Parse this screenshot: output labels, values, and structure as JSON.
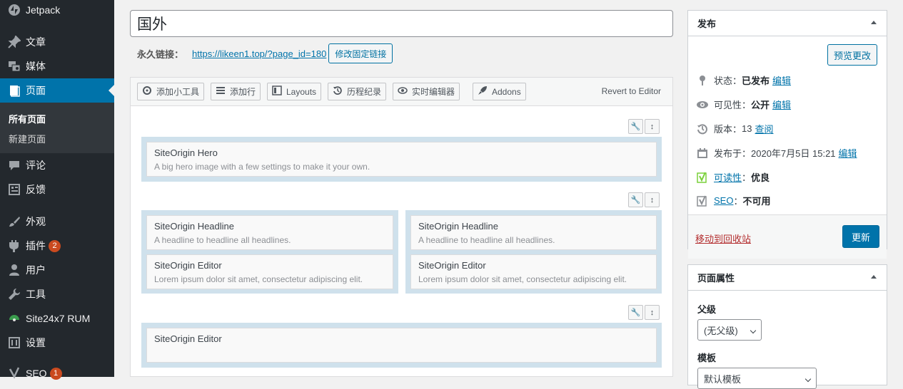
{
  "sidebar": {
    "items": [
      {
        "label": "Jetpack",
        "icon": "jetpack-icon"
      },
      {
        "label": "文章",
        "icon": "pin-icon"
      },
      {
        "label": "媒体",
        "icon": "media-icon"
      },
      {
        "label": "页面",
        "icon": "page-icon"
      },
      {
        "label": "评论",
        "icon": "comment-icon"
      },
      {
        "label": "反馈",
        "icon": "feedback-icon"
      },
      {
        "label": "外观",
        "icon": "brush-icon"
      },
      {
        "label": "插件",
        "icon": "plugin-icon",
        "badge": "2"
      },
      {
        "label": "用户",
        "icon": "user-icon"
      },
      {
        "label": "工具",
        "icon": "wrench-icon"
      },
      {
        "label": "Site24x7 RUM",
        "icon": "site24x7-icon"
      },
      {
        "label": "设置",
        "icon": "settings-icon"
      },
      {
        "label": "SEO",
        "icon": "yoast-icon",
        "badge": "1"
      }
    ],
    "submenu": [
      "所有页面",
      "新建页面"
    ],
    "colors": {
      "bg": "#23282d",
      "current": "#0073aa"
    }
  },
  "post": {
    "title": "国外",
    "permalink_label": "永久链接：",
    "permalink_url": "https://likeen1.top/?page_id=180",
    "permalink_edit": "修改固定链接"
  },
  "builder": {
    "toolbar": [
      {
        "label": "添加小工具",
        "icon": "gear-icon"
      },
      {
        "label": "添加行",
        "icon": "menu-icon"
      },
      {
        "label": "Layouts",
        "icon": "layout-icon"
      },
      {
        "label": "历程纪录",
        "icon": "history-icon"
      },
      {
        "label": "实时编辑器",
        "icon": "eye-icon"
      },
      {
        "label": "Addons",
        "icon": "rocket-icon"
      }
    ],
    "revert": "Revert to Editor",
    "rows": [
      {
        "widgets": [
          {
            "title": "SiteOrigin Hero",
            "desc": "A big hero image with a few settings to make it your own."
          }
        ]
      },
      {
        "cols": [
          [
            {
              "title": "SiteOrigin Headline",
              "desc": "A headline to headline all headlines."
            },
            {
              "title": "SiteOrigin Editor",
              "desc": "Lorem ipsum dolor sit amet, consectetur adipiscing elit."
            }
          ],
          [
            {
              "title": "SiteOrigin Headline",
              "desc": "A headline to headline all headlines."
            },
            {
              "title": "SiteOrigin Editor",
              "desc": "Lorem ipsum dolor sit amet, consectetur adipiscing elit."
            }
          ]
        ]
      },
      {
        "widgets": [
          {
            "title": "SiteOrigin Editor",
            "desc": ""
          }
        ]
      }
    ]
  },
  "publish": {
    "title": "发布",
    "preview": "预览更改",
    "status_label": "状态：",
    "status_value": "已发布",
    "edit": "编辑",
    "visibility_label": "可见性：",
    "visibility_value": "公开",
    "revisions_label": "版本：",
    "revisions_value": "13",
    "revisions_link": "查阅",
    "published_label": "发布于：",
    "published_value": "2020年7月5日 15:21",
    "readability_link": "可读性",
    "readability_sep": "：",
    "readability_value": "优良",
    "seo_link": "SEO",
    "seo_sep": "：",
    "seo_value": "不可用",
    "trash": "移动到回收站",
    "update": "更新"
  },
  "page_attributes": {
    "title": "页面属性",
    "parent_label": "父级",
    "parent_value": "(无父级)",
    "template_label": "模板",
    "template_value": "默认模板"
  }
}
